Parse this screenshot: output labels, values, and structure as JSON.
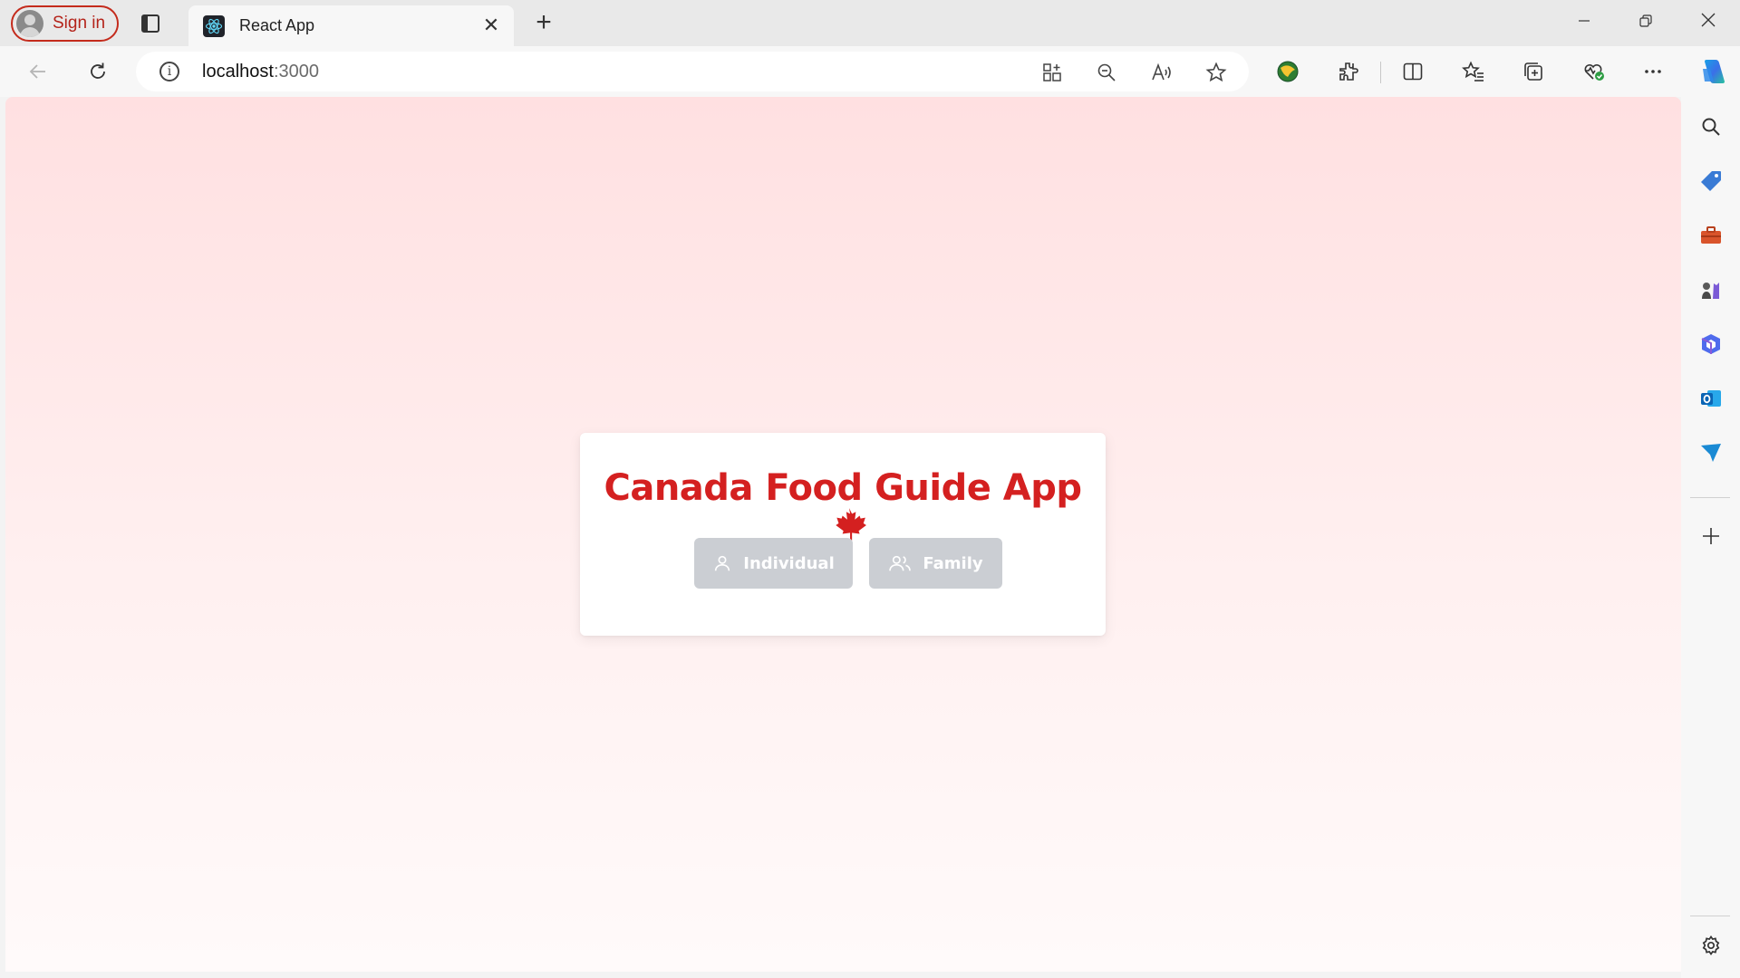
{
  "browser": {
    "signin_label": "Sign in",
    "tab_title": "React App",
    "url_host": "localhost",
    "url_port": ":3000"
  },
  "app": {
    "title": "Canada Food Guide App",
    "buttons": {
      "individual": "Individual",
      "family": "Family"
    }
  },
  "colors": {
    "title_red": "#d42020",
    "button_disabled": "#cbced3",
    "background_top": "#ffe0e1"
  },
  "icons": {
    "title": "maple-leaf-icon",
    "individual": "user-icon",
    "family": "users-icon"
  }
}
